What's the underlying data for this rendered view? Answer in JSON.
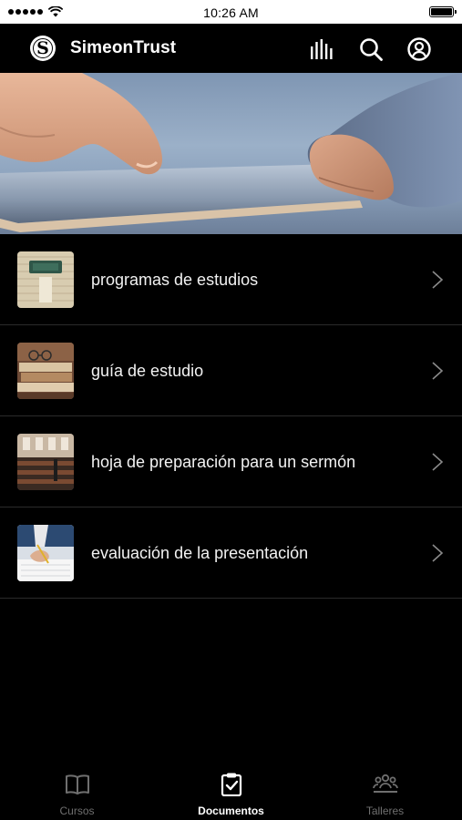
{
  "status_bar": {
    "time": "10:26 AM"
  },
  "header": {
    "logo_letter": "S",
    "title": "SimeonTrust",
    "icons": [
      "stats-icon",
      "search-icon",
      "account-icon"
    ]
  },
  "documents": [
    {
      "label": "programas de estudios",
      "thumbnail": "notebook-photo"
    },
    {
      "label": "guía de estudio",
      "thumbnail": "books-glasses-photo"
    },
    {
      "label": "hoja de preparación para un sermón",
      "thumbnail": "lecture-hall-photo"
    },
    {
      "label": "evaluación de la presentación",
      "thumbnail": "writing-hand-photo"
    }
  ],
  "tab_bar": {
    "tabs": [
      {
        "label": "Cursos",
        "icon": "book-icon",
        "active": false
      },
      {
        "label": "Documentos",
        "icon": "clipboard-check-icon",
        "active": true
      },
      {
        "label": "Talleres",
        "icon": "group-icon",
        "active": false
      }
    ]
  },
  "colors": {
    "background": "#000000",
    "text": "#ffffff",
    "inactive_tab": "#6f6f6f",
    "divider": "#2b2b2b"
  }
}
